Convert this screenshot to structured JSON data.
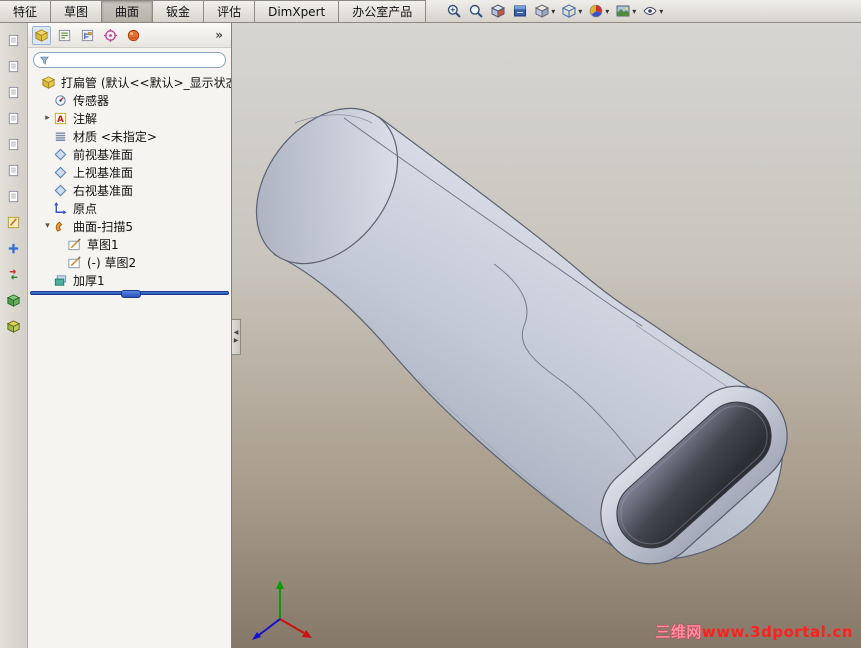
{
  "command_tabs": [
    {
      "id": "features",
      "label": "特征",
      "active": false
    },
    {
      "id": "sketch",
      "label": "草图",
      "active": false
    },
    {
      "id": "surfaces",
      "label": "曲面",
      "active": true
    },
    {
      "id": "sheet-metal",
      "label": "钣金",
      "active": false
    },
    {
      "id": "evaluate",
      "label": "评估",
      "active": false
    },
    {
      "id": "dimxpert",
      "label": "DimXpert",
      "active": false
    },
    {
      "id": "office-products",
      "label": "办公室产品",
      "active": false
    }
  ],
  "view_toolbar": [
    {
      "icon": "zoom-window",
      "caret": false
    },
    {
      "icon": "zoom-fit",
      "caret": false
    },
    {
      "icon": "section-view",
      "caret": false
    },
    {
      "icon": "view-orientation",
      "caret": false
    },
    {
      "icon": "display-style",
      "caret": true
    },
    {
      "icon": "hide-show-items",
      "caret": true
    },
    {
      "icon": "edit-appearance",
      "caret": true
    },
    {
      "icon": "apply-scene",
      "caret": true
    },
    {
      "icon": "view-settings",
      "caret": true
    }
  ],
  "side_toolbar": [
    "document",
    "document",
    "document",
    "document",
    "document",
    "document",
    "document",
    "pencil-edit",
    "add-new",
    "rebuild-arrows",
    "green-cube",
    "yellow-cube"
  ],
  "feature_panel": {
    "manager_tabs": [
      {
        "icon": "feature-manager",
        "current": true
      },
      {
        "icon": "property-manager",
        "current": false
      },
      {
        "icon": "configuration-manager",
        "current": false
      },
      {
        "icon": "dimxpert-manager",
        "current": false
      },
      {
        "icon": "display-manager",
        "current": false
      }
    ],
    "overflow_label": "»",
    "filter_value": ""
  },
  "feature_tree": {
    "root": {
      "id": "part-root",
      "label": "打扁管 (默认<<默认>_显示状态",
      "icon": "part"
    },
    "items": [
      {
        "id": "sensors",
        "label": "传感器",
        "icon": "sensor",
        "indent": 0,
        "expander": ""
      },
      {
        "id": "annotations",
        "label": "注解",
        "icon": "annotation",
        "indent": 0,
        "expander": "collapsed"
      },
      {
        "id": "material",
        "label": "材质 <未指定>",
        "icon": "material",
        "indent": 0,
        "expander": ""
      },
      {
        "id": "front-plane",
        "label": "前视基准面",
        "icon": "plane",
        "indent": 0,
        "expander": ""
      },
      {
        "id": "top-plane",
        "label": "上视基准面",
        "icon": "plane",
        "indent": 0,
        "expander": ""
      },
      {
        "id": "right-plane",
        "label": "右视基准面",
        "icon": "plane",
        "indent": 0,
        "expander": ""
      },
      {
        "id": "origin",
        "label": "原点",
        "icon": "origin",
        "indent": 0,
        "expander": ""
      },
      {
        "id": "surface-sweep5",
        "label": "曲面-扫描5",
        "icon": "surface-sweep",
        "indent": 0,
        "expander": "expanded"
      },
      {
        "id": "sketch1",
        "label": "草图1",
        "icon": "sketch",
        "indent": 1,
        "expander": ""
      },
      {
        "id": "sketch2",
        "label": "(-) 草图2",
        "icon": "sketch",
        "indent": 1,
        "expander": ""
      },
      {
        "id": "thicken1",
        "label": "加厚1",
        "icon": "thicken",
        "indent": 0,
        "expander": ""
      }
    ],
    "rollback_after": "thicken1"
  },
  "watermark": {
    "prefix": "三维网",
    "url": "www.3dportal.cn"
  },
  "colors": {
    "rollback_bar": "#2a52b8",
    "watermark_red": "#ff1f1f",
    "viewport_top": "#d6d5d2",
    "viewport_bottom": "#857868",
    "model_body": "#c3c9d6"
  }
}
